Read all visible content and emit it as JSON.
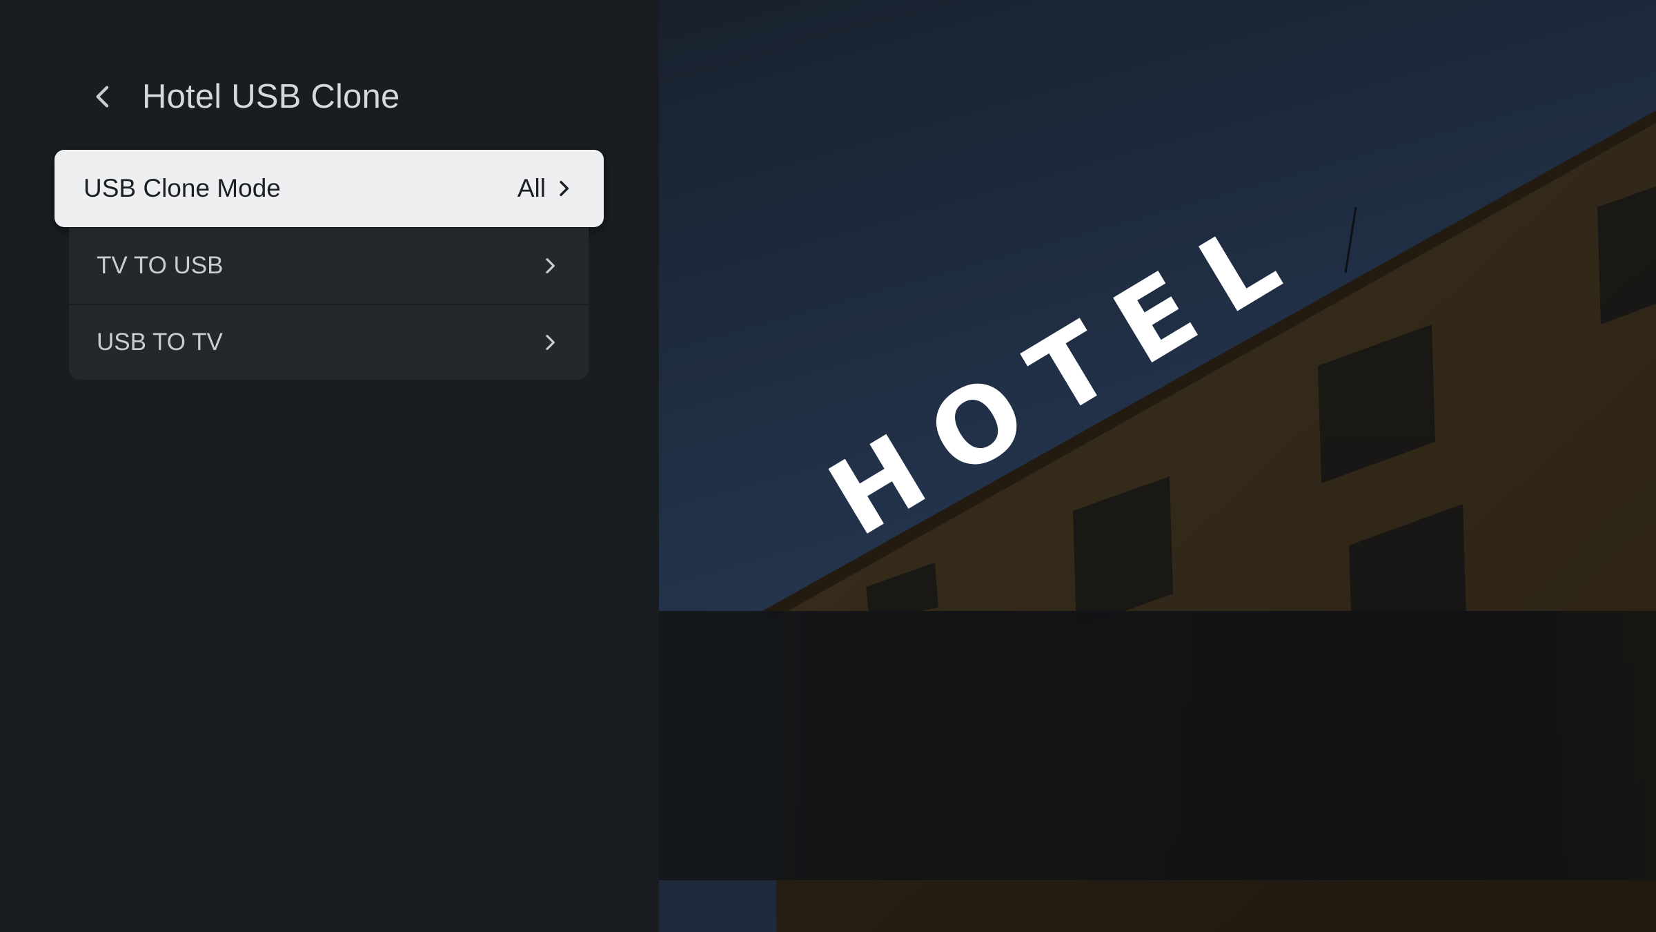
{
  "header": {
    "title": "Hotel USB Clone"
  },
  "focused_item": {
    "label": "USB Clone Mode",
    "value": "All"
  },
  "menu": {
    "items": [
      {
        "label": "TV TO USB"
      },
      {
        "label": "USB TO TV"
      }
    ]
  },
  "background": {
    "sign_text": "HOTEL"
  },
  "colors": {
    "panel": "#191c20",
    "focus_bg": "#eeeff1",
    "sky": "#1b2636",
    "building": "#3a2e1c"
  }
}
